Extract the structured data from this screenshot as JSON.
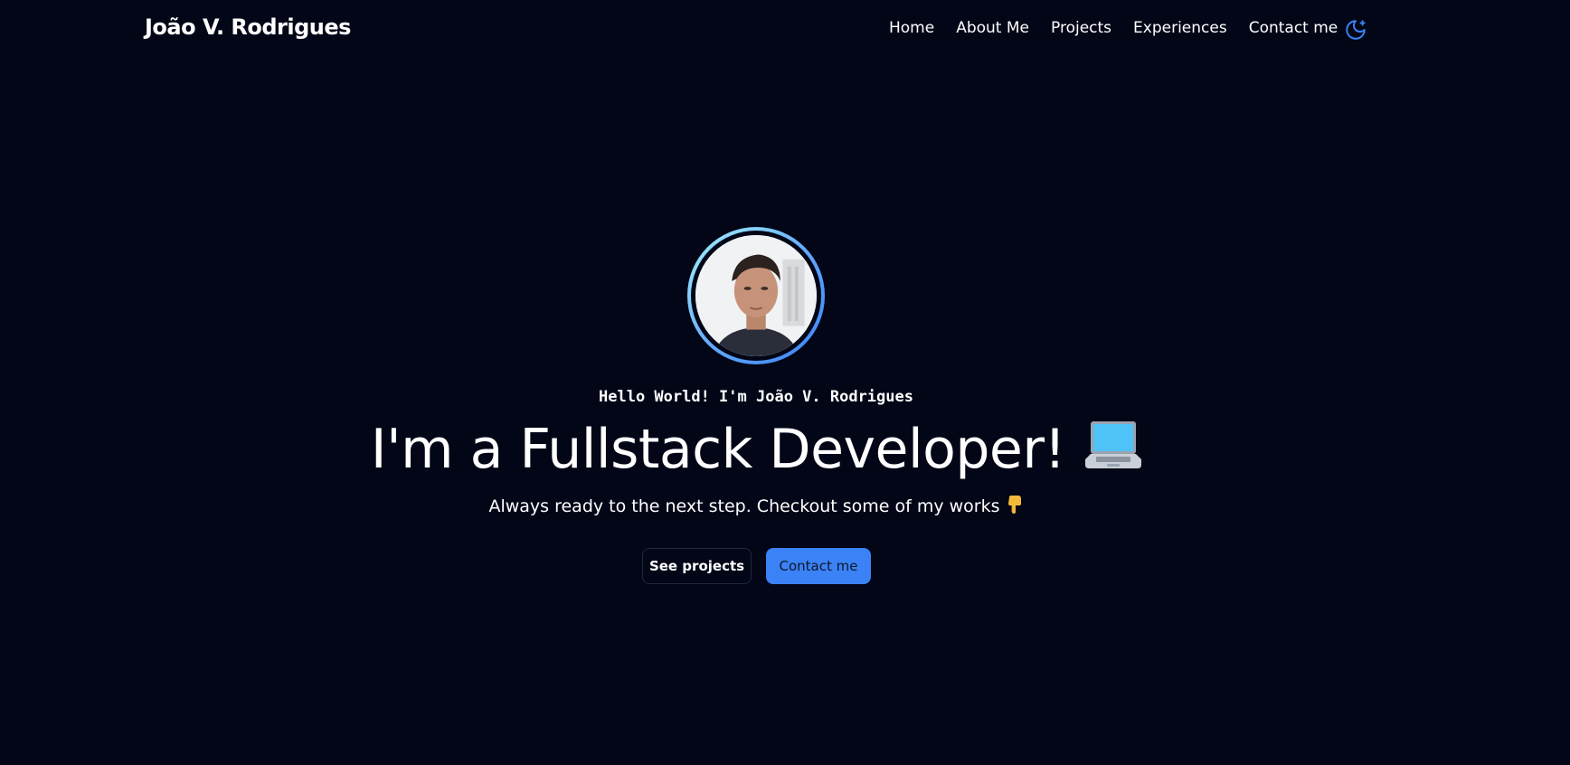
{
  "header": {
    "brand": "João V. Rodrigues",
    "nav": [
      {
        "label": "Home"
      },
      {
        "label": "About Me"
      },
      {
        "label": "Projects"
      },
      {
        "label": "Experiences"
      },
      {
        "label": "Contact me"
      }
    ],
    "theme_icon": "moon-stars-icon",
    "accent": "#3b82f6"
  },
  "hero": {
    "avatar": "profile-photo",
    "greeting": "Hello World! I'm João V. Rodrigues",
    "headline": "I'm a Fullstack Developer!",
    "headline_icon": "laptop-icon",
    "subline": "Always ready to the next step. Checkout some of my works",
    "subline_icon": "pointing-down-hand-icon",
    "buttons": {
      "see_projects": "See projects",
      "contact_me": "Contact me"
    }
  },
  "colors": {
    "background": "#020617",
    "text": "#ffffff",
    "primary": "#3b82f6",
    "ring_start": "#a5f3fc",
    "ring_end": "#3b82f6"
  }
}
